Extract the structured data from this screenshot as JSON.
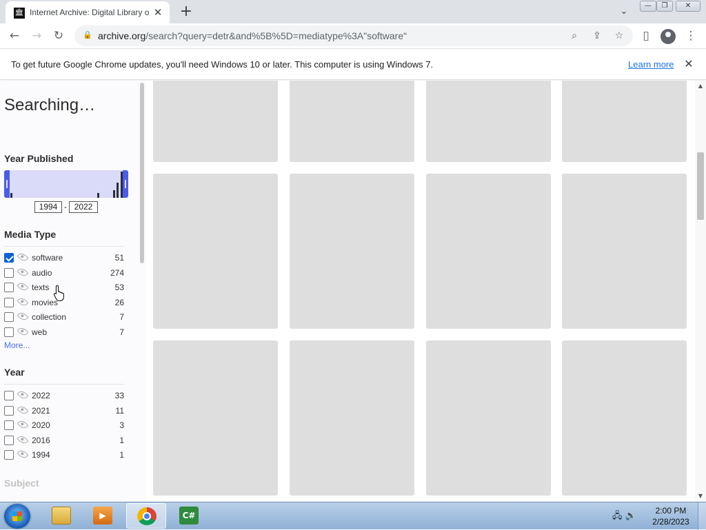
{
  "browser": {
    "tab_title": "Internet Archive: Digital Library o",
    "tab_close": "✕",
    "new_tab": "+",
    "tab_list": "⌄",
    "window_controls": {
      "minimize": "—",
      "maximize": "❐",
      "close": "✕"
    }
  },
  "toolbar": {
    "back": "←",
    "forward": "→",
    "reload": "↻",
    "url_host": "archive.org",
    "url_path": "/search?query=detr&and%5B%5D=mediatype%3A\"software\"",
    "lock": "🔒",
    "search_icon": "⌕",
    "share_icon": "⇪",
    "star_icon": "☆",
    "sidepanel_icon": "▯",
    "menu_icon": "⋮"
  },
  "infobar": {
    "message": "To get future Google Chrome updates, you'll need Windows 10 or later. This computer is using Windows 7.",
    "link": "Learn more",
    "close": "✕"
  },
  "sidebar": {
    "status": "Searching…",
    "year_published": {
      "title": "Year Published",
      "from": "1994",
      "to": "2022",
      "separator": "-",
      "histogram": [
        {
          "year": 1994,
          "count": 1
        },
        {
          "year": 2016,
          "count": 1
        },
        {
          "year": 2020,
          "count": 3
        },
        {
          "year": 2021,
          "count": 11
        },
        {
          "year": 2022,
          "count": 33
        }
      ]
    },
    "media_type": {
      "title": "Media Type",
      "items": [
        {
          "label": "software",
          "count": "51",
          "checked": true
        },
        {
          "label": "audio",
          "count": "274",
          "checked": false
        },
        {
          "label": "texts",
          "count": "53",
          "checked": false
        },
        {
          "label": "movies",
          "count": "26",
          "checked": false
        },
        {
          "label": "collection",
          "count": "7",
          "checked": false
        },
        {
          "label": "web",
          "count": "7",
          "checked": false
        }
      ],
      "more": "More..."
    },
    "year": {
      "title": "Year",
      "items": [
        {
          "label": "2022",
          "count": "33",
          "checked": false
        },
        {
          "label": "2021",
          "count": "11",
          "checked": false
        },
        {
          "label": "2020",
          "count": "3",
          "checked": false
        },
        {
          "label": "2016",
          "count": "1",
          "checked": false
        },
        {
          "label": "1994",
          "count": "1",
          "checked": false
        }
      ]
    },
    "subject": {
      "title": "Subject"
    }
  },
  "results": {
    "placeholder_color": "#dedede"
  },
  "taskbar": {
    "apps": [
      {
        "name": "explorer",
        "label": ""
      },
      {
        "name": "media-player",
        "label": ""
      },
      {
        "name": "chrome",
        "label": "",
        "active": true
      },
      {
        "name": "csharp",
        "label": "C#"
      }
    ],
    "time": "2:00 PM",
    "date": "2/28/2023",
    "tray_icons": "🖧 🔊"
  },
  "colors": {
    "accent": "#4a5ce8",
    "checkbox": "#0b62d6",
    "link": "#1a73e8"
  }
}
